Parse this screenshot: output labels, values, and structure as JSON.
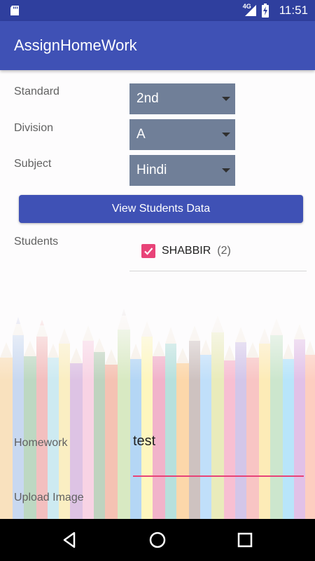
{
  "status_bar": {
    "network_label": "4G",
    "time": "11:51",
    "icons": [
      "sd-card-icon",
      "signal-icon",
      "battery-charging-icon"
    ]
  },
  "app_bar": {
    "title": "AssignHomeWork"
  },
  "form": {
    "standard": {
      "label": "Standard",
      "value": "2nd"
    },
    "division": {
      "label": "Division",
      "value": "A"
    },
    "subject": {
      "label": "Subject",
      "value": "Hindi"
    },
    "view_button_label": "View Students Data",
    "students": {
      "label": "Students",
      "items": [
        {
          "name": "SHABBIR",
          "count": "(2)",
          "checked": true
        }
      ]
    },
    "homework": {
      "label": "Homework",
      "value": "test"
    },
    "upload_image": {
      "label": "Upload Image"
    }
  },
  "nav_bar": {
    "icons": [
      "back-icon",
      "home-icon",
      "recents-icon"
    ]
  },
  "colors": {
    "status_bar": "#2f3f9e",
    "primary": "#3f51b5",
    "accent": "#e84378",
    "spinner": "#707f98"
  }
}
